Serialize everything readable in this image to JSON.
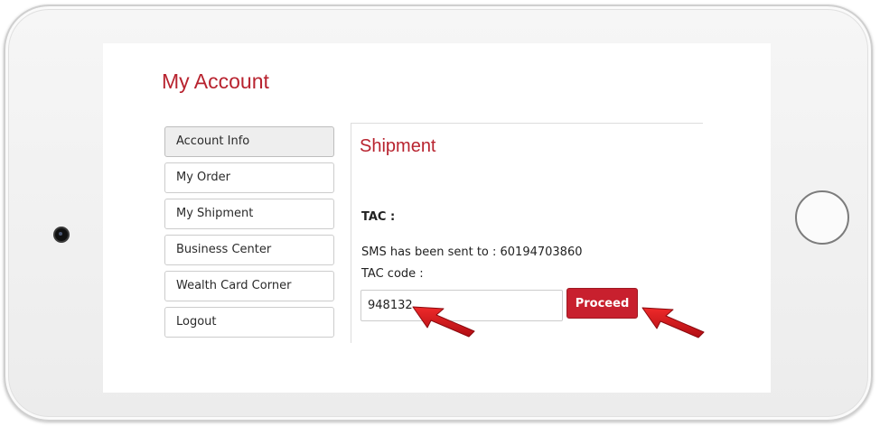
{
  "page": {
    "title": "My Account"
  },
  "sidebar": {
    "items": [
      {
        "label": "Account Info",
        "active": true
      },
      {
        "label": "My Order",
        "active": false
      },
      {
        "label": "My Shipment",
        "active": false
      },
      {
        "label": "Business Center",
        "active": false
      },
      {
        "label": "Wealth Card Corner",
        "active": false
      },
      {
        "label": "Logout",
        "active": false
      }
    ]
  },
  "main": {
    "section_title": "Shipment",
    "tac_label": "TAC :",
    "sms_text": "SMS has been sent to : 60194703860",
    "tac_code_label": "TAC code :",
    "tac_input_value": "948132",
    "proceed_label": "Proceed"
  },
  "colors": {
    "accent": "#b8232f",
    "button": "#c8202e",
    "annotation_arrow": "#d7141d"
  },
  "annotations": [
    {
      "icon": "red-arrow-icon",
      "points_to": "tac-input"
    },
    {
      "icon": "red-arrow-icon",
      "points_to": "proceed-button"
    }
  ]
}
